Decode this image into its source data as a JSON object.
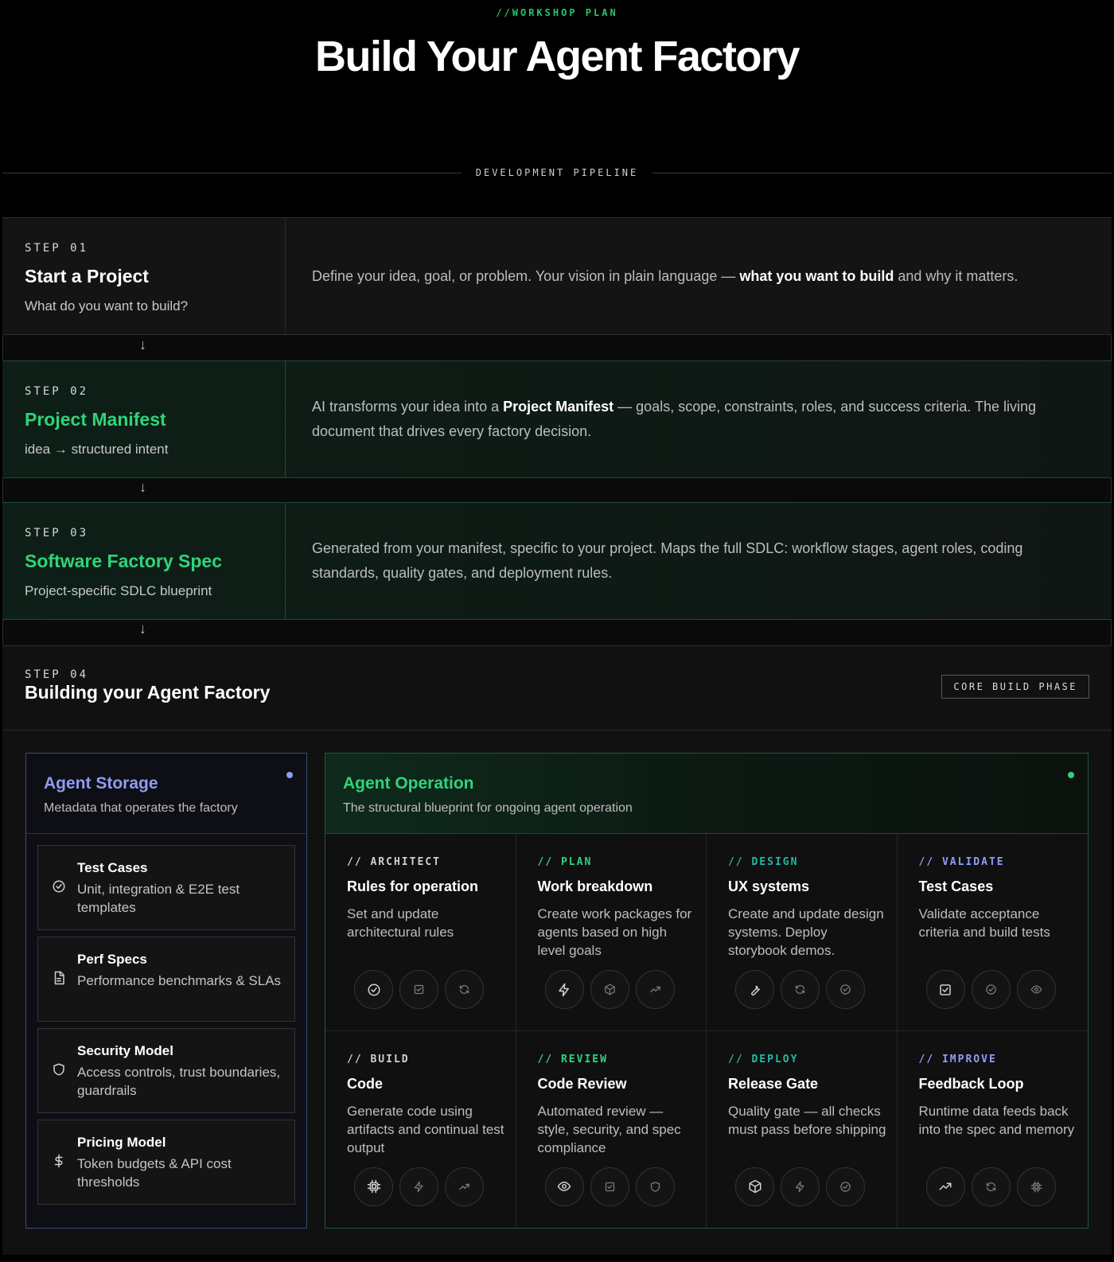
{
  "header": {
    "eyebrow": "//WORKSHOP PLAN",
    "title": "Build Your Agent Factory"
  },
  "pipeline_label": "DEVELOPMENT PIPELINE",
  "steps": [
    {
      "num": "STEP 01",
      "title": "Start a Project",
      "sub": "What do you want to build?",
      "desc_pre": "Define your idea, goal, or problem. Your vision in plain language — ",
      "desc_bold": "what you want to build",
      "desc_post": " and why it matters."
    },
    {
      "num": "STEP 02",
      "title": "Project Manifest",
      "sub": "idea → structured intent",
      "desc_pre": "AI transforms your idea into a ",
      "desc_bold": "Project Manifest",
      "desc_post": " — goals, scope, constraints, roles, and success criteria. The living document that drives every factory decision."
    },
    {
      "num": "STEP 03",
      "title": "Software Factory Spec",
      "sub": "Project-specific SDLC blueprint",
      "desc_pre": "Generated from your manifest, specific to your project. Maps the full SDLC: workflow stages, agent roles, coding standards, quality gates, and deployment rules.",
      "desc_bold": "",
      "desc_post": ""
    }
  ],
  "step4": {
    "num": "STEP 04",
    "title": "Building your Agent Factory",
    "badge": "CORE BUILD PHASE"
  },
  "storage": {
    "title": "Agent Storage",
    "sub": "Metadata that operates the factory",
    "accent": "#8f9cf5",
    "cards": [
      {
        "icon": "check-circle-icon",
        "title": "Test Cases",
        "desc": "Unit, integration & E2E test templates"
      },
      {
        "icon": "document-icon",
        "title": "Perf Specs",
        "desc": "Performance benchmarks & SLAs"
      },
      {
        "icon": "shield-icon",
        "title": "Security Model",
        "desc": "Access controls, trust boundaries, guardrails"
      },
      {
        "icon": "dollar-icon",
        "title": "Pricing Model",
        "desc": "Token budgets & API cost thresholds"
      }
    ]
  },
  "operation": {
    "title": "Agent Operation",
    "sub": "The structural blueprint for ongoing agent operation",
    "accent": "#2fd47a",
    "cells": [
      {
        "tag": "// ARCHITECT",
        "tag_color": "#cfcfcf",
        "title": "Rules for operation",
        "desc": "Set and update architectural rules",
        "icons": [
          "check-circle-icon",
          "checkbox-icon",
          "refresh-icon"
        ]
      },
      {
        "tag": "// PLAN",
        "tag_color": "#2fd47a",
        "title": "Work breakdown",
        "desc": "Create work packages for agents based on high level goals",
        "icons": [
          "bolt-icon",
          "cube-icon",
          "trend-icon"
        ]
      },
      {
        "tag": "// DESIGN",
        "tag_color": "#22b8a8",
        "title": "UX systems",
        "desc": "Create and update design systems. Deploy storybook demos.",
        "icons": [
          "wrench-icon",
          "refresh-icon",
          "check-circle-icon"
        ]
      },
      {
        "tag": "// VALIDATE",
        "tag_color": "#8f9cf5",
        "title": "Test Cases",
        "desc": "Validate acceptance criteria and build tests",
        "icons": [
          "checkbox-icon",
          "check-circle-icon",
          "eye-icon"
        ]
      },
      {
        "tag": "// BUILD",
        "tag_color": "#cfcfcf",
        "title": "Code",
        "desc": "Generate code using artifacts and continual test output",
        "icons": [
          "chip-icon",
          "bolt-icon",
          "trend-icon"
        ]
      },
      {
        "tag": "// REVIEW",
        "tag_color": "#2fd47a",
        "title": "Code Review",
        "desc": "Automated review — style, security, and spec compliance",
        "icons": [
          "eye-icon",
          "checkbox-icon",
          "shield-icon"
        ]
      },
      {
        "tag": "// DEPLOY",
        "tag_color": "#22b8a8",
        "title": "Release Gate",
        "desc": "Quality gate — all checks must pass before shipping",
        "icons": [
          "cube-icon",
          "bolt-icon",
          "check-circle-icon"
        ]
      },
      {
        "tag": "// IMPROVE",
        "tag_color": "#8f9cf5",
        "title": "Feedback Loop",
        "desc": "Runtime data feeds back into the spec and memory",
        "icons": [
          "trend-icon",
          "refresh-icon",
          "chip-icon"
        ]
      }
    ]
  }
}
